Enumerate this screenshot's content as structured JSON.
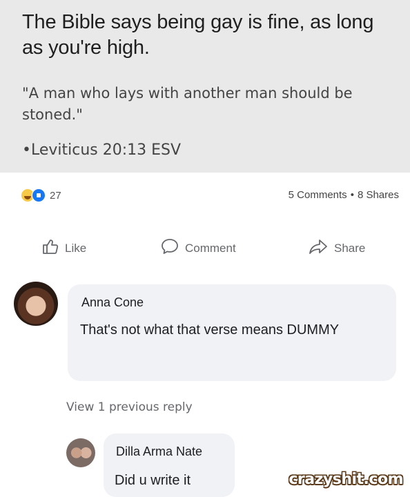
{
  "post": {
    "headline": "The Bible says being gay is fine, as long as you're high.",
    "quote": "\"A man who lays with another man should be stoned.\"",
    "citation": "•Leviticus 20:13 ESV"
  },
  "stats": {
    "reaction_count": "27",
    "comments": "5 Comments",
    "separator": "•",
    "shares": "8 Shares"
  },
  "actions": {
    "like_label": "Like",
    "comment_label": "Comment",
    "share_label": "Share"
  },
  "comments": [
    {
      "author": "Anna Cone",
      "text": "That's not what that verse means DUMMY"
    },
    {
      "author": "Dilla Arma Nate",
      "text": "Did u write it"
    }
  ],
  "view_previous_label": "View 1 previous reply",
  "watermark": "crazyshit.com",
  "colors": {
    "post_background": "#e9e9ea",
    "bubble_background": "#f0f2f5",
    "action_text": "#65676b",
    "like_blue": "#1877f2",
    "haha_yellow": "#f7c948"
  },
  "icons": [
    "haha-reaction-icon",
    "like-reaction-icon",
    "thumbs-up-icon",
    "speech-bubble-icon",
    "share-arrow-icon"
  ]
}
